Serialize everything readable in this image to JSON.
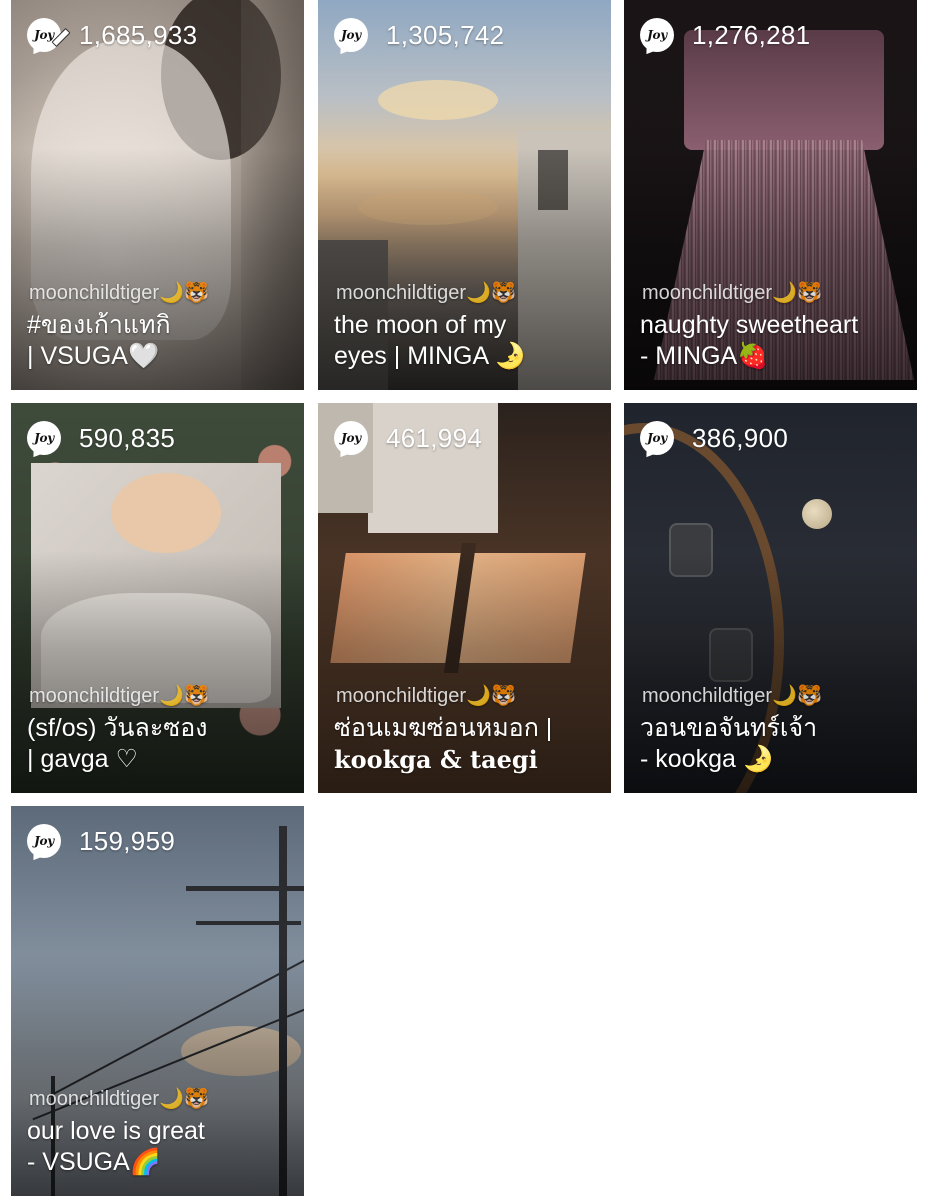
{
  "cards": [
    {
      "count": "1,685,933",
      "author": "moonchildtiger🌙🐯",
      "title_line1": "#ของเก้าแทกิ",
      "title_line2": "| VSUGA🤍",
      "has_pen": true
    },
    {
      "count": "1,305,742",
      "author": "moonchildtiger🌙🐯",
      "title_line1": "the moon of my",
      "title_line2": "eyes | MINGA 🌛"
    },
    {
      "count": "1,276,281",
      "author": "moonchildtiger🌙🐯",
      "title_line1": "naughty sweetheart",
      "title_line2": "- MINGA🍓"
    },
    {
      "count": "590,835",
      "author": "moonchildtiger🌙🐯",
      "title_line1": "(sf/os) วันละซอง",
      "title_line2": "| gavga ♡"
    },
    {
      "count": "461,994",
      "author": "moonchildtiger🌙🐯",
      "title_line1": "ซ่อนเมฆซ่อนหมอก |",
      "title_line2": "kookga & taegi"
    },
    {
      "count": "386,900",
      "author": "moonchildtiger🌙🐯",
      "title_line1": "วอนขอจันทร์เจ้า",
      "title_line2": "- kookga 🌛"
    },
    {
      "count": "159,959",
      "author": "moonchildtiger🌙🐯",
      "title_line1": "our love is great",
      "title_line2": "- VSUGA🌈"
    }
  ],
  "joy_logo": "Joy",
  "icons": {
    "joy": "joy-speech-bubble-icon",
    "pen": "pen-icon"
  }
}
